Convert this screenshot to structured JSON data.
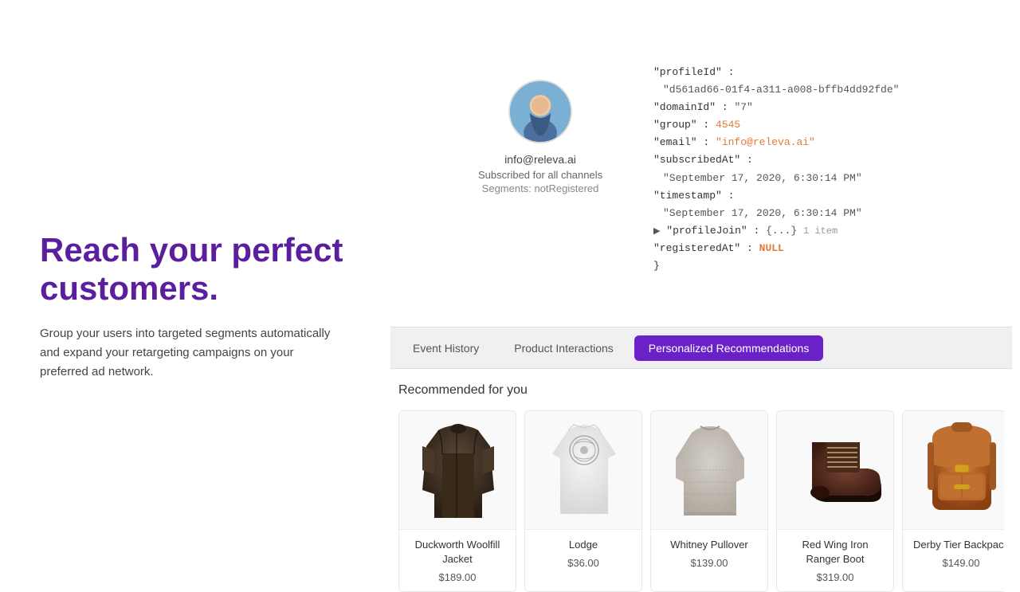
{
  "hero": {
    "title": "Reach your perfect customers.",
    "subtitle": "Group your users into targeted segments automatically and expand your retargeting campaigns on your preferred ad network."
  },
  "profile": {
    "email": "info@releva.ai",
    "subscribed": "Subscribed for all channels",
    "segments_label": "Segments:",
    "segments_value": "notRegistered"
  },
  "json_data": {
    "profileId_key": "\"profileId\" :",
    "profileId_val": "\"d561ad66-01f4-a311-a008-bffb4dd92fde\"",
    "domainId_key": "\"domainId\" :",
    "domainId_val": "\"7\"",
    "group_key": "\"group\" :",
    "group_val": "4545",
    "email_key": "\"email\" :",
    "email_val": "\"info@releva.ai\"",
    "subscribedAt_key": "\"subscribedAt\" :",
    "subscribedAt_val": "\"September 17, 2020, 6:30:14 PM\"",
    "timestamp_key": "\"timestamp\" :",
    "timestamp_val": "\"September 17, 2020, 6:30:14 PM\"",
    "profileJoin_key": "\"profileJoin\" :",
    "profileJoin_val": "{...}",
    "profileJoin_count": "1 item",
    "registeredAt_key": "\"registeredAt\" :",
    "registeredAt_val": "NULL",
    "closing_brace": "}"
  },
  "tabs": [
    {
      "id": "event-history",
      "label": "Event History",
      "active": false
    },
    {
      "id": "product-interactions",
      "label": "Product Interactions",
      "active": false
    },
    {
      "id": "personalized-recommendations",
      "label": "Personalized Recommendations",
      "active": true
    }
  ],
  "recommended": {
    "title": "Recommended for you",
    "products": [
      {
        "id": "duckworth",
        "name": "Duckworth Woolfill Jacket",
        "price": "$189.00",
        "color": "#3a2d22"
      },
      {
        "id": "lodge",
        "name": "Lodge",
        "price": "$36.00",
        "color": "#e8e8e8"
      },
      {
        "id": "whitney",
        "name": "Whitney Pullover",
        "price": "$139.00",
        "color": "#c8c0b8"
      },
      {
        "id": "redwing",
        "name": "Red Wing Iron Ranger Boot",
        "price": "$319.00",
        "color": "#6b3a2a"
      },
      {
        "id": "derby",
        "name": "Derby Tier Backpack",
        "price": "$149.00",
        "color": "#c87940"
      }
    ]
  }
}
